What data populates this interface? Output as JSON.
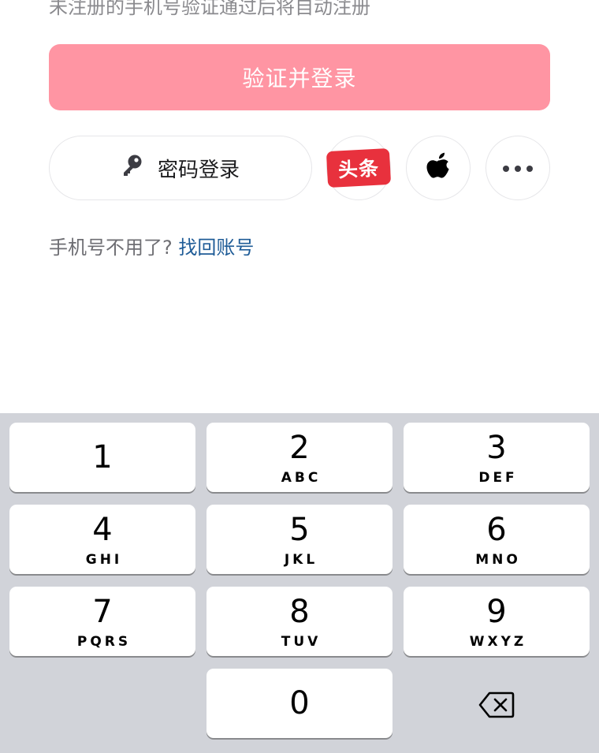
{
  "hint_text": "未注册的手机号验证通过后将自动注册",
  "primary_button": {
    "label": "验证并登录",
    "color": "#ff95a3"
  },
  "password_login": {
    "label": "密码登录",
    "icon": "key-icon"
  },
  "third_party": {
    "toutiao": {
      "label": "头条",
      "color": "#e8313d"
    },
    "apple": {
      "icon": "apple-icon"
    },
    "more": {
      "icon": "more-icon"
    }
  },
  "recover": {
    "prefix": "手机号不用了?",
    "link": "找回账号",
    "link_color": "#1f5c97"
  },
  "keypad": {
    "keys": [
      {
        "num": "1",
        "letters": ""
      },
      {
        "num": "2",
        "letters": "ABC"
      },
      {
        "num": "3",
        "letters": "DEF"
      },
      {
        "num": "4",
        "letters": "GHI"
      },
      {
        "num": "5",
        "letters": "JKL"
      },
      {
        "num": "6",
        "letters": "MNO"
      },
      {
        "num": "7",
        "letters": "PQRS"
      },
      {
        "num": "8",
        "letters": "TUV"
      },
      {
        "num": "9",
        "letters": "WXYZ"
      }
    ],
    "zero": {
      "num": "0",
      "letters": ""
    },
    "delete_icon": "backspace-icon",
    "background": "#d1d3d9"
  }
}
